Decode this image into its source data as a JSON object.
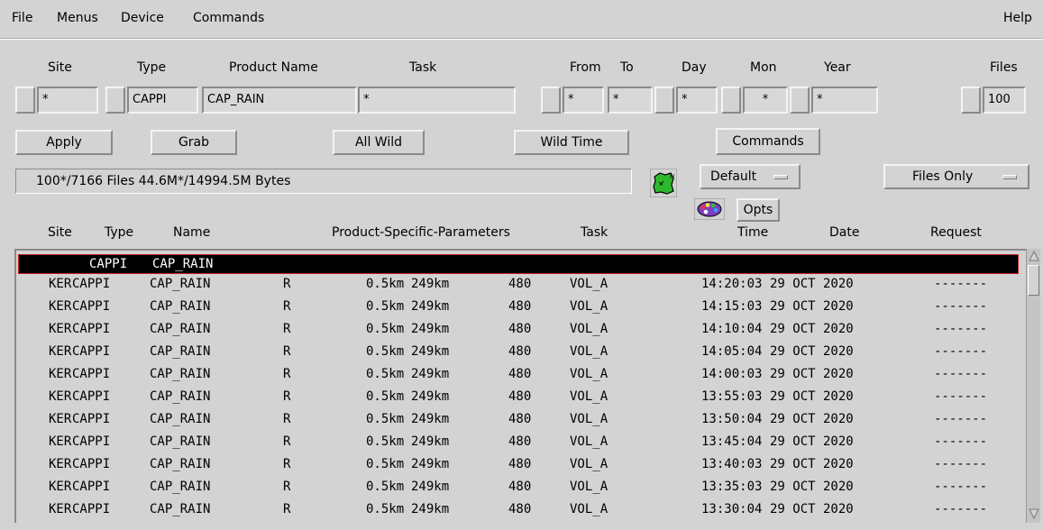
{
  "menu": {
    "file": "File",
    "menus": "Menus",
    "device": "Device",
    "commands": "Commands",
    "help": "Help"
  },
  "filters": {
    "labels": {
      "site": "Site",
      "type": "Type",
      "product_name": "Product Name",
      "task": "Task",
      "from": "From",
      "to": "To",
      "day": "Day",
      "mon": "Mon",
      "year": "Year",
      "files": "Files"
    },
    "values": {
      "site": "*",
      "type": "CAPPI",
      "product_name": "CAP_RAIN",
      "task": "*",
      "from": "*",
      "to": "*",
      "day": "*",
      "mon": "*",
      "year": "*",
      "files": "100"
    }
  },
  "buttons": {
    "apply": "Apply",
    "grab": "Grab",
    "all_wild": "All Wild",
    "wild_time": "Wild Time",
    "commands": "Commands",
    "opts": "Opts"
  },
  "status": {
    "summary": "100*/7166 Files  44.6M*/14994.5M Bytes"
  },
  "selectors": {
    "default": "Default",
    "files_only": "Files Only"
  },
  "icons": {
    "map": "map-icon",
    "palette": "palette-icon"
  },
  "colors": {
    "selection_bg": "#000000",
    "selection_border": "#c81e1e",
    "map_green": "#2db82d"
  },
  "columns": {
    "site": "Site",
    "type": "Type",
    "name": "Name",
    "params": "Product-Specific-Parameters",
    "task": "Task",
    "time": "Time",
    "date": "Date",
    "request": "Request"
  },
  "selected_row": {
    "type": "CAPPI",
    "name": "CAP_RAIN"
  },
  "rows": [
    {
      "site": "KER",
      "type": "CAPPI",
      "name": "CAP_RAIN",
      "flag": "R",
      "height": "0.5km",
      "range": "249km",
      "size": "480",
      "task": "VOL_A",
      "time": "14:20:03",
      "date": "29 OCT 2020",
      "request": "-------"
    },
    {
      "site": "KER",
      "type": "CAPPI",
      "name": "CAP_RAIN",
      "flag": "R",
      "height": "0.5km",
      "range": "249km",
      "size": "480",
      "task": "VOL_A",
      "time": "14:15:03",
      "date": "29 OCT 2020",
      "request": "-------"
    },
    {
      "site": "KER",
      "type": "CAPPI",
      "name": "CAP_RAIN",
      "flag": "R",
      "height": "0.5km",
      "range": "249km",
      "size": "480",
      "task": "VOL_A",
      "time": "14:10:04",
      "date": "29 OCT 2020",
      "request": "-------"
    },
    {
      "site": "KER",
      "type": "CAPPI",
      "name": "CAP_RAIN",
      "flag": "R",
      "height": "0.5km",
      "range": "249km",
      "size": "480",
      "task": "VOL_A",
      "time": "14:05:04",
      "date": "29 OCT 2020",
      "request": "-------"
    },
    {
      "site": "KER",
      "type": "CAPPI",
      "name": "CAP_RAIN",
      "flag": "R",
      "height": "0.5km",
      "range": "249km",
      "size": "480",
      "task": "VOL_A",
      "time": "14:00:03",
      "date": "29 OCT 2020",
      "request": "-------"
    },
    {
      "site": "KER",
      "type": "CAPPI",
      "name": "CAP_RAIN",
      "flag": "R",
      "height": "0.5km",
      "range": "249km",
      "size": "480",
      "task": "VOL_A",
      "time": "13:55:03",
      "date": "29 OCT 2020",
      "request": "-------"
    },
    {
      "site": "KER",
      "type": "CAPPI",
      "name": "CAP_RAIN",
      "flag": "R",
      "height": "0.5km",
      "range": "249km",
      "size": "480",
      "task": "VOL_A",
      "time": "13:50:04",
      "date": "29 OCT 2020",
      "request": "-------"
    },
    {
      "site": "KER",
      "type": "CAPPI",
      "name": "CAP_RAIN",
      "flag": "R",
      "height": "0.5km",
      "range": "249km",
      "size": "480",
      "task": "VOL_A",
      "time": "13:45:04",
      "date": "29 OCT 2020",
      "request": "-------"
    },
    {
      "site": "KER",
      "type": "CAPPI",
      "name": "CAP_RAIN",
      "flag": "R",
      "height": "0.5km",
      "range": "249km",
      "size": "480",
      "task": "VOL_A",
      "time": "13:40:03",
      "date": "29 OCT 2020",
      "request": "-------"
    },
    {
      "site": "KER",
      "type": "CAPPI",
      "name": "CAP_RAIN",
      "flag": "R",
      "height": "0.5km",
      "range": "249km",
      "size": "480",
      "task": "VOL_A",
      "time": "13:35:03",
      "date": "29 OCT 2020",
      "request": "-------"
    },
    {
      "site": "KER",
      "type": "CAPPI",
      "name": "CAP_RAIN",
      "flag": "R",
      "height": "0.5km",
      "range": "249km",
      "size": "480",
      "task": "VOL_A",
      "time": "13:30:04",
      "date": "29 OCT 2020",
      "request": "-------"
    }
  ]
}
